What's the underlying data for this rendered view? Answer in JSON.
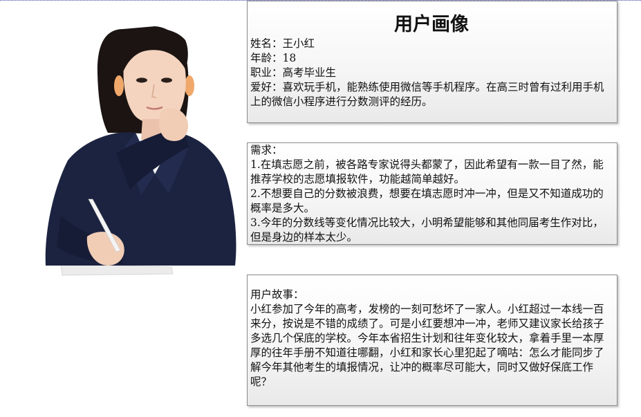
{
  "profile": {
    "title": "用户画像",
    "name_label": "姓名：",
    "name": "王小红",
    "age_label": "年龄：",
    "age": "18",
    "job_label": "职业：",
    "job": "高考毕业生",
    "hobby_label": "爱好：",
    "hobby": "喜欢玩手机，能熟练使用微信等手机程序。在高三时曾有过利用手机上的微信小程序进行分数测评的经历。"
  },
  "needs": {
    "heading": "需求：",
    "items": [
      "1.在填志愿之前，被各路专家说得头都蒙了，因此希望有一款一目了然，能推荐学校的志愿填报软件，功能越简单越好。",
      "2.不想要自己的分数被浪费，想要在填志愿时冲一冲，但是又不知道成功的概率是多大。",
      "3.今年的分数线等变化情况比较大，小明希望能够和其他同届考生作对比，但是身边的样本太少。"
    ]
  },
  "story": {
    "heading": "用户故事：",
    "text": "小红参加了今年的高考，发榜的一刻可愁坏了一家人。小红超过一本线一百来分，按说是不错的成绩了。可是小红要想冲一冲，老师又建议家长给孩子多选几个保底的学校。今年本省招生计划和往年变化较大，拿着手里一本厚厚的往年手册不知道往哪翻，小红和家长心里犯起了嘀咕：怎么才能同步了解今年其他考生的填报情况，让冲的概率尽可能大，同时又做好保底工作呢？"
  }
}
